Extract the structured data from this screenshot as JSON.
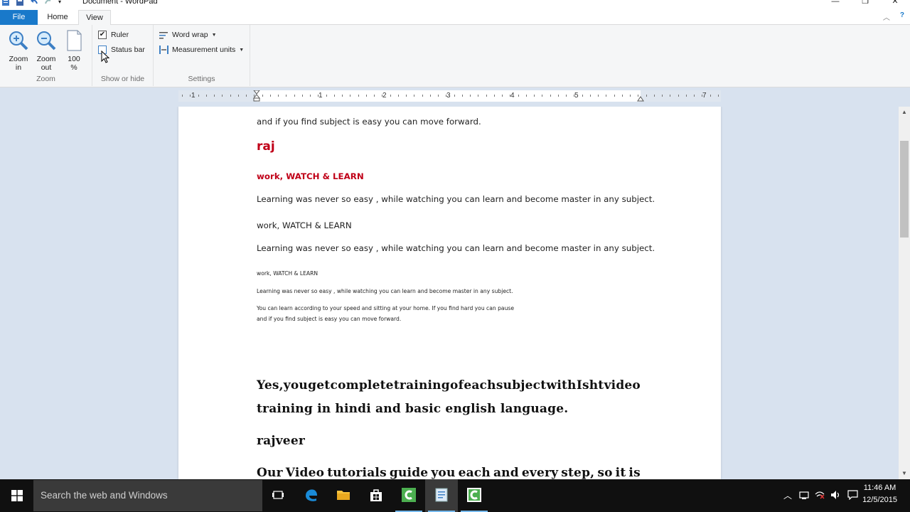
{
  "window": {
    "title": "Document - WordPad",
    "minimize": "—",
    "restore": "❐",
    "close": "✕"
  },
  "ribbon": {
    "tabs": {
      "file": "File",
      "home": "Home",
      "view": "View"
    },
    "zoom_group": {
      "label": "Zoom",
      "zoom_in": "Zoom in",
      "zoom_out": "Zoom out",
      "hundred": "100 %"
    },
    "show_hide_group": {
      "label": "Show or hide",
      "ruler": {
        "label": "Ruler",
        "checked": true
      },
      "status_bar": {
        "label": "Status bar",
        "checked": false
      }
    },
    "settings_group": {
      "label": "Settings",
      "word_wrap": "Word wrap",
      "measurement_units": "Measurement units"
    }
  },
  "ruler": {
    "numbers": [
      "1",
      "1",
      "2",
      "3",
      "4",
      "5",
      "7"
    ]
  },
  "document": {
    "line1": "and if you find subject is easy you can move forward.",
    "line2": "raj",
    "line3": "work, WATCH & LEARN",
    "line4": "Learning was never so easy , while watching you can learn and become master in any subject.",
    "line5": "work, WATCH & LEARN",
    "line6": "Learning was never so easy , while watching you can learn and become master in any subject.",
    "line7": "work, WATCH & LEARN",
    "line8": "Learning was never so easy , while watching you can learn and become master in any subject.",
    "line9": "You can learn according to your speed and sitting at your home. If you find hard you can pause",
    "line10": "and if you find subject is easy you can move forward.",
    "para1_line1": [
      "Yes,you",
      "get",
      "complete",
      "training",
      "of",
      "each",
      "subject",
      "with",
      "Isht",
      "video"
    ],
    "para1_line2": "training in hindi and basic english language.",
    "line11": "rajveer",
    "para2_line1": [
      "Our",
      "Video",
      "tutorials",
      "guide",
      "you",
      "each",
      "and",
      "every",
      "step,",
      "so",
      "it",
      "is"
    ]
  },
  "taskbar": {
    "search_placeholder": "Search the web and Windows",
    "time": "11:46 AM",
    "date": "12/5/2015"
  },
  "colors": {
    "file_tab": "#1979ca",
    "heading_red": "#c00018",
    "canvas_bg": "#d8e2ef",
    "taskbar": "#101010"
  }
}
